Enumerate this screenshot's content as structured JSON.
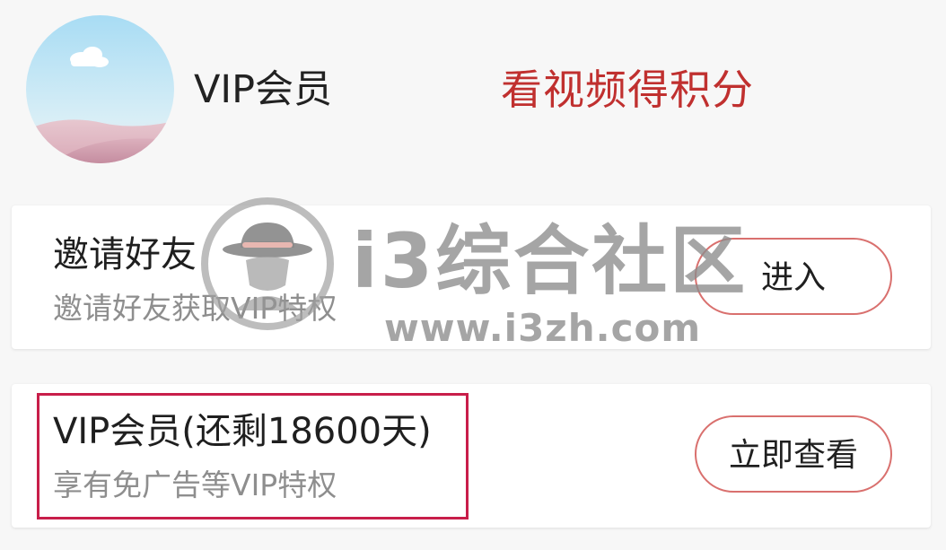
{
  "header": {
    "title": "VIP会员",
    "earn_points_label": "看视频得积分"
  },
  "cards": {
    "invite": {
      "title": "邀请好友",
      "subtitle": "邀请好友获取VIP特权",
      "button_label": "进入"
    },
    "vip": {
      "title": "VIP会员(还剩18600天)",
      "subtitle": "享有免广告等VIP特权",
      "button_label": "立即查看"
    }
  },
  "watermark": {
    "site_name": "i3综合社区",
    "url": "www.i3zh.com"
  },
  "colors": {
    "accent_red": "#c0302f",
    "button_border": "#d9706e",
    "highlight_border": "#c81e4a",
    "subtitle_gray": "#8e8e8e"
  },
  "icons": {
    "avatar": "avatar-sky-dunes",
    "watermark_logo": "hat-mascot-logo"
  }
}
